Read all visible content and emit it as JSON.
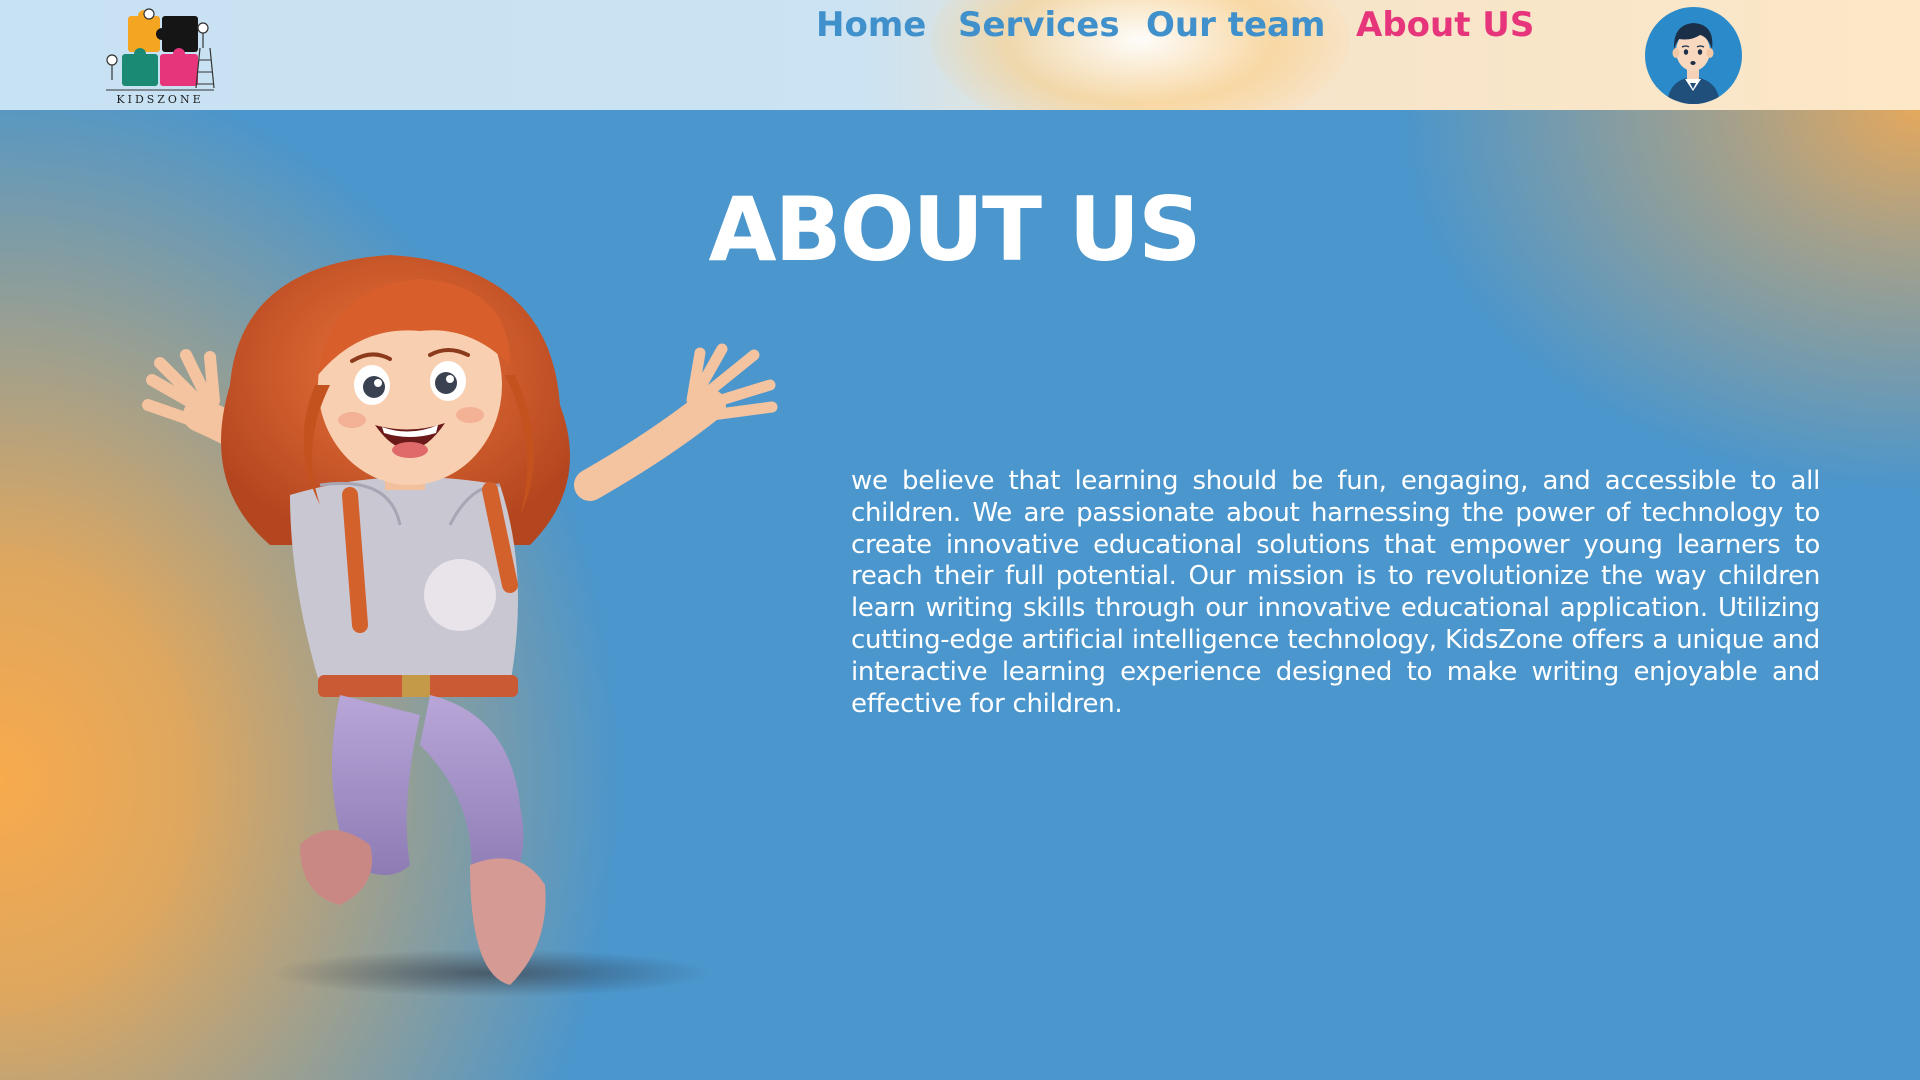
{
  "header": {
    "logo": {
      "text": "KIDSZONE",
      "icon": "puzzle-logo-icon"
    },
    "nav": [
      {
        "label": "Home",
        "active": false
      },
      {
        "label": "Services",
        "active": false
      },
      {
        "label": "Our team",
        "active": false
      },
      {
        "label": "About US",
        "active": true
      }
    ],
    "avatar_icon": "user-avatar-icon"
  },
  "main": {
    "title": "ABOUT US",
    "body": "we believe that learning should be fun, engaging, and accessible to all children. We are passionate about harnessing the power of technology to create innovative educational solutions that empower young learners to reach their full potential. Our mission is to revolutionize the way children learn writing skills through our innovative educational application. Utilizing cutting-edge artificial intelligence technology, KidsZone offers a unique and interactive learning experience designed to make writing enjoyable and effective for children.",
    "hero_image": "jumping-girl-illustration"
  },
  "colors": {
    "nav": "#3f90cb",
    "nav_active": "#e7357b",
    "background_blue": "#4b96cc",
    "background_orange": "#f8aa4c",
    "text": "#ffffff"
  }
}
